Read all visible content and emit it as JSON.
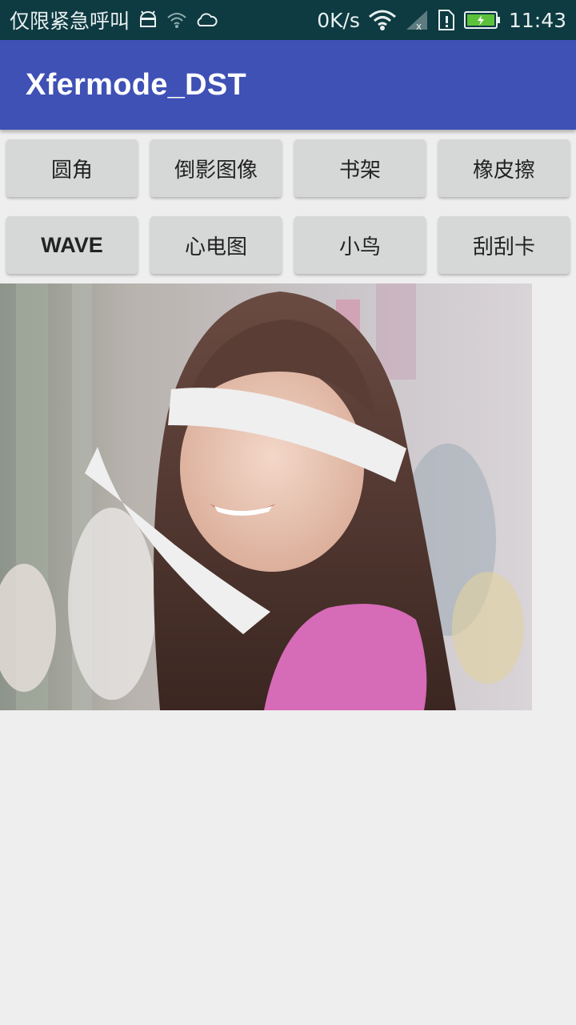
{
  "status_bar": {
    "left_text": "仅限紧急呼叫",
    "net_speed": "0K/s",
    "time": "11:43",
    "icons": [
      "android-icon",
      "wifi-signal-icon",
      "weather-cloud-icon",
      "wifi-icon",
      "cellular-signal-icon",
      "sim-alert-icon",
      "battery-icon"
    ]
  },
  "app_bar": {
    "title": "Xfermode_DST"
  },
  "buttons": [
    {
      "label": "圆角"
    },
    {
      "label": "倒影图像"
    },
    {
      "label": "书架"
    },
    {
      "label": "橡皮擦"
    },
    {
      "label": "WAVE"
    },
    {
      "label": "心电图"
    },
    {
      "label": "小鸟"
    },
    {
      "label": "刮刮卡"
    }
  ],
  "image": {
    "subject": "photo of smiling girl with long brown hair and pink top, partially erased by white strokes"
  },
  "colors": {
    "status_bar": "#0e3a41",
    "app_bar": "#3f51b5",
    "button": "#d6d7d7",
    "background": "#eeeeee",
    "eraser": "#efefef"
  }
}
